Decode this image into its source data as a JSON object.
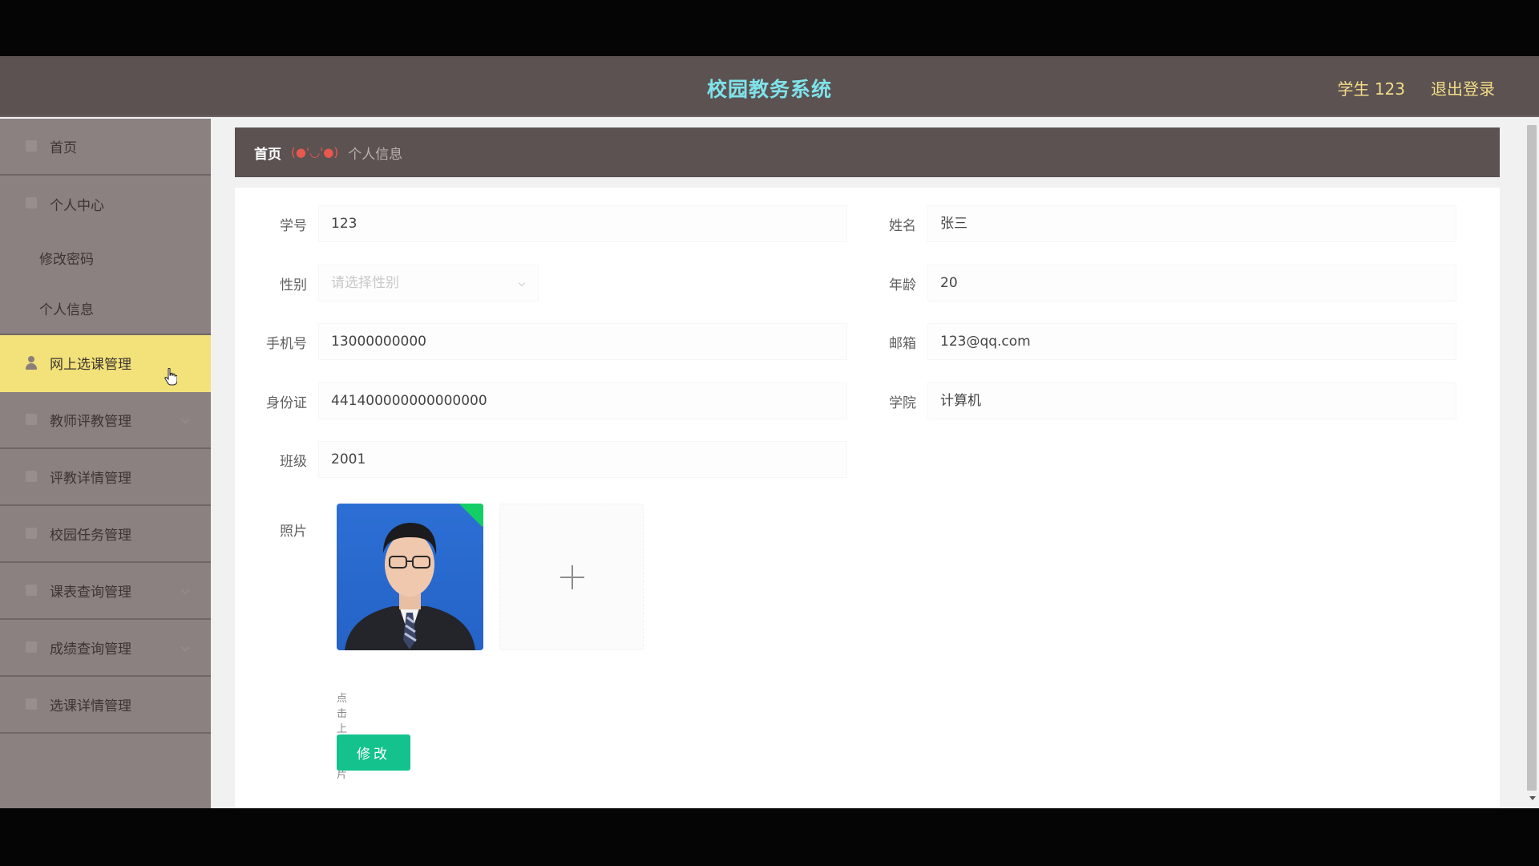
{
  "header": {
    "app_title": "校园教务系统",
    "user_label": "学生 123",
    "logout_label": "退出登录"
  },
  "sidebar": {
    "items": [
      {
        "label": "首页"
      },
      {
        "label": "个人中心",
        "children": [
          {
            "label": "修改密码"
          },
          {
            "label": "个人信息"
          }
        ]
      },
      {
        "label": "网上选课管理"
      },
      {
        "label": "教师评教管理"
      },
      {
        "label": "评教详情管理"
      },
      {
        "label": "校园任务管理"
      },
      {
        "label": "课表查询管理"
      },
      {
        "label": "成绩查询管理"
      },
      {
        "label": "选课详情管理"
      }
    ]
  },
  "breadcrumb": {
    "home": "首页",
    "separator": "(●'◡'●)",
    "current": "个人信息"
  },
  "form": {
    "student_id": {
      "label": "学号",
      "value": "123"
    },
    "name": {
      "label": "姓名",
      "value": "张三"
    },
    "gender": {
      "label": "性别",
      "placeholder": "请选择性别"
    },
    "age": {
      "label": "年龄",
      "value": "20"
    },
    "phone": {
      "label": "手机号",
      "value": "13000000000"
    },
    "email": {
      "label": "邮箱",
      "value": "123@qq.com"
    },
    "id_card": {
      "label": "身份证",
      "value": "441400000000000000"
    },
    "college": {
      "label": "学院",
      "value": "计算机"
    },
    "class": {
      "label": "班级",
      "value": "2001"
    },
    "photo": {
      "label": "照片",
      "tip": "点击上传照片"
    },
    "submit_label": "修改"
  },
  "colors": {
    "title": "#7fe3ea",
    "header_text": "#f3dc87",
    "active_menu": "#f3e17a",
    "submit_button": "#13c28d",
    "breadcrumb_separator": "#e8584e"
  }
}
